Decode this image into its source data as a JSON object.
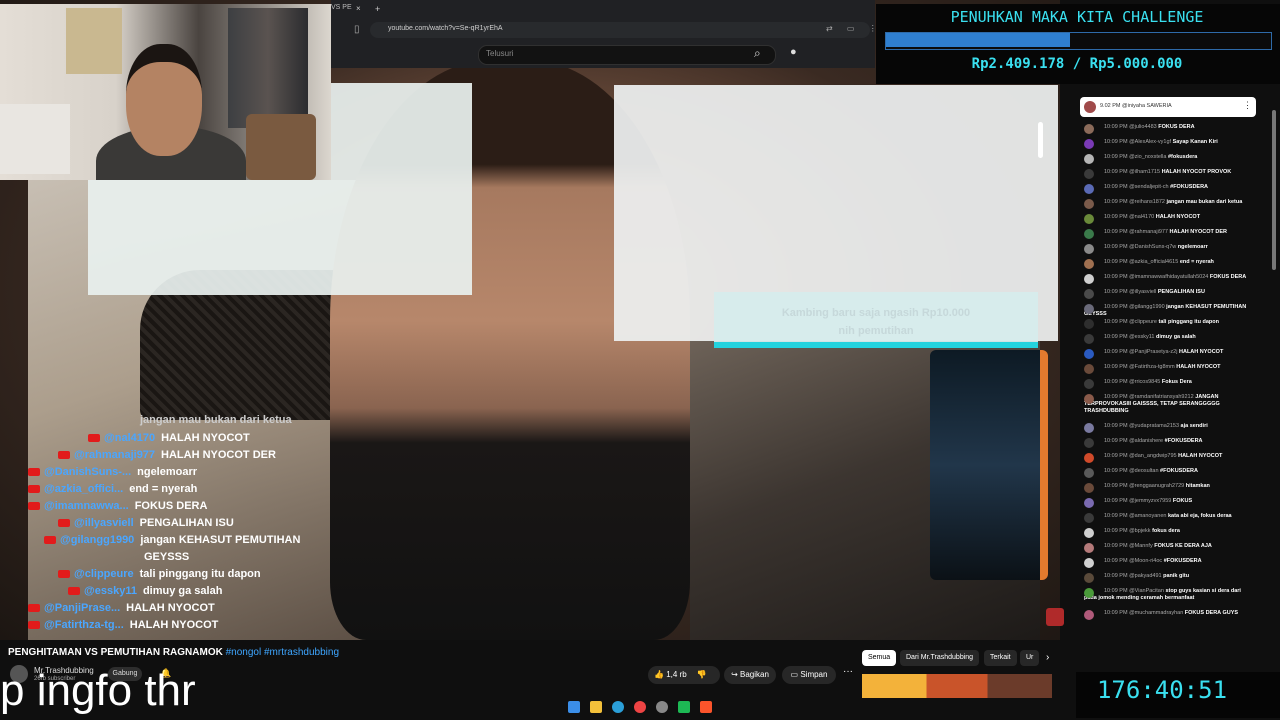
{
  "browser": {
    "tab_label": "VS PE",
    "tab_close": "×",
    "tab_new": "+",
    "url": "youtube.com/watch?v=Se-qR1yrEhA",
    "search_placeholder": "Telusuri"
  },
  "goal": {
    "title": "PENUHKAN MAKA KITA CHALLENGE",
    "raised": "Rp2.409.178",
    "target": "Rp5.000.000",
    "amount_text": "Rp2.409.178 / Rp5.000.000",
    "progress_fraction": 0.48
  },
  "donation_alert": {
    "line1": "Kambing baru saja ngasih Rp10.000",
    "line2": "nih pemutihan"
  },
  "pinned": {
    "text": "9.02 PM  @iniyaha  SAWERIA"
  },
  "chat_panel": [
    {
      "time": "10:09 PM",
      "user": "@julio4483",
      "text": "FOKUS DERA",
      "color": "#8b6b5a"
    },
    {
      "time": "10:09 PM",
      "user": "@AlexAlex-vy1gf",
      "text": "Sayap Kanan Kiri",
      "color": "#7a3ab5"
    },
    {
      "time": "10:09 PM",
      "user": "@zio_noxstella",
      "text": "#fokusdera",
      "color": "#b5b5b5"
    },
    {
      "time": "10:09 PM",
      "user": "@ilham1715",
      "text": "HALAH NYOCOT PROVOK",
      "color": "#3a3a3a"
    },
    {
      "time": "10:09 PM",
      "user": "@sendaljepit-ch",
      "text": "#FOKUSDERA",
      "color": "#5a6ab5"
    },
    {
      "time": "10:09 PM",
      "user": "@reihans1872",
      "text": "jangan mau bukan dari ketua",
      "color": "#7a5a4a"
    },
    {
      "time": "10:09 PM",
      "user": "@nal4170",
      "text": "HALAH NYOCOT",
      "color": "#6a8a3a"
    },
    {
      "time": "10:09 PM",
      "user": "@rahmanaji977",
      "text": "HALAH NYOCOT DER",
      "color": "#3a7a4a"
    },
    {
      "time": "10:09 PM",
      "user": "@DanishSuns-q7w",
      "text": "ngelemoarr",
      "color": "#8a8a8a"
    },
    {
      "time": "10:09 PM",
      "user": "@azkia_official4615",
      "text": "end = nyerah",
      "color": "#a07050"
    },
    {
      "time": "10:09 PM",
      "user": "@imamnawwafhidayatullah5024",
      "text": "FOKUS DERA",
      "color": "#cfcfcf"
    },
    {
      "time": "10:09 PM",
      "user": "@illyasviell",
      "text": "PENGALIHAN ISU",
      "color": "#4a4a4a"
    },
    {
      "time": "10:09 PM",
      "user": "@gilangg1990",
      "text": "jangan KEHASUT PEMUTIHAN GEYSSS",
      "color": "#6a6a7a"
    },
    {
      "time": "10:09 PM",
      "user": "@clippeure",
      "text": "tali pinggang itu dapon",
      "color": "#2e2e2e"
    },
    {
      "time": "10:09 PM",
      "user": "@essky11",
      "text": "dimuy ga salah",
      "color": "#3a3a3a"
    },
    {
      "time": "10:09 PM",
      "user": "@PanjiPrasetya-z2j",
      "text": "HALAH NYOCOT",
      "color": "#2a5ac0"
    },
    {
      "time": "10:09 PM",
      "user": "@Fatirthza-tg8mm",
      "text": "HALAH NYOCOT",
      "color": "#6a4a3a"
    },
    {
      "time": "10:09 PM",
      "user": "@rricos9845",
      "text": "Fokus Dera",
      "color": "#3a3a3a"
    },
    {
      "time": "10:09 PM",
      "user": "@ramdanifatriansyah9212",
      "text": "JANGAN TERPROVOKASIII GAISSSS, TETAP SERANGGGGG TRASHDUBBING",
      "color": "#8a5a4a"
    },
    {
      "time": "10:09 PM",
      "user": "@yudapratama2153",
      "text": "aja sendiri",
      "color": "#7a7aa0"
    },
    {
      "time": "10:09 PM",
      "user": "@aldanishere",
      "text": "#FOKUSDERA",
      "color": "#3a3a3a"
    },
    {
      "time": "10:09 PM",
      "user": "@dan_angdwip795",
      "text": "HALAH NYOCOT",
      "color": "#d04a2a"
    },
    {
      "time": "10:09 PM",
      "user": "@deosultan",
      "text": "#FOKUSDERA",
      "color": "#5a5a5a"
    },
    {
      "time": "10:09 PM",
      "user": "@renggaanugrah2729",
      "text": "hitamkan",
      "color": "#6a4a3a"
    },
    {
      "time": "10:09 PM",
      "user": "@jemmyzvx7959",
      "text": "FOKUS",
      "color": "#7a6ab0"
    },
    {
      "time": "10:09 PM",
      "user": "@amanoyanen",
      "text": "kata abi eja, fokus deraa",
      "color": "#3a3a3a"
    },
    {
      "time": "10:09 PM",
      "user": "@bpjekk",
      "text": "fokus dera",
      "color": "#cfcfcf"
    },
    {
      "time": "10:09 PM",
      "user": "@Mannfy",
      "text": "FOKUS KE DERA AJA",
      "color": "#b57a7a"
    },
    {
      "time": "10:09 PM",
      "user": "@Moon-ri4oc",
      "text": "#FOKUSDERA",
      "color": "#d0d0d0"
    },
    {
      "time": "10:09 PM",
      "user": "@pakyad491",
      "text": "panik gitu",
      "color": "#5a4a3a"
    },
    {
      "time": "10:09 PM",
      "user": "@VianPacitan",
      "text": "stop guys kasian si dera dari pada jomok mending ceramah bermanfaat",
      "color": "#4a9a3a"
    },
    {
      "time": "10:09 PM",
      "user": "@muchammadrayhan",
      "text": "FOKUS DERA GUYS",
      "color": "#b05a7a"
    }
  ],
  "stream_chat": {
    "top_partial": "jangan mau bukan dari ketua",
    "items": [
      {
        "user": "@nal4170",
        "text": "HALAH NYOCOT",
        "indent": 60
      },
      {
        "user": "@rahmanaji977",
        "text": "HALAH NYOCOT DER",
        "indent": 30
      },
      {
        "user": "@DanishSuns-...",
        "text": "ngelemoarr",
        "indent": 0
      },
      {
        "user": "@azkia_offici...",
        "text": "end = nyerah",
        "indent": 0
      },
      {
        "user": "@imamnawwa...",
        "text": "FOKUS DERA",
        "indent": 0
      },
      {
        "user": "@illyasviell",
        "text": "PENGALIHAN ISU",
        "indent": 30
      },
      {
        "user": "@gilangg1990",
        "text": "jangan KEHASUT PEMUTIHAN",
        "indent": 16
      },
      {
        "user": "",
        "text": "GEYSSS",
        "indent": 116
      },
      {
        "user": "@clippeure",
        "text": "tali pinggang itu dapon",
        "indent": 30
      },
      {
        "user": "@essky11",
        "text": "dimuy ga salah",
        "indent": 40
      },
      {
        "user": "@PanjiPrase...",
        "text": "HALAH NYOCOT",
        "indent": 0
      },
      {
        "user": "@Fatirthza-tg...",
        "text": "HALAH NYOCOT",
        "indent": 0
      }
    ]
  },
  "video": {
    "title": "PENGHITAMAN VS PEMUTIHAN RAGNAMOK",
    "tags": "#nongol #mrtrashdubbing",
    "channel": "Mr.Trashdubbing",
    "subs": "26rb subscriber",
    "join_label": "Gabung",
    "like_count": "1,4 rb",
    "share_label": "Bagikan",
    "save_label": "Simpan",
    "more_label": "···"
  },
  "chips": [
    "Semua",
    "Dari Mr.Trashdubbing",
    "Terkait",
    "Ur"
  ],
  "subtitle": "p ingfo thr",
  "timer": "176:40:51",
  "colors": {
    "accent": "#3ae0f0",
    "goal_fill": "#2f7fd0",
    "link": "#3ea6ff",
    "yt_red": "#e21b1b"
  }
}
